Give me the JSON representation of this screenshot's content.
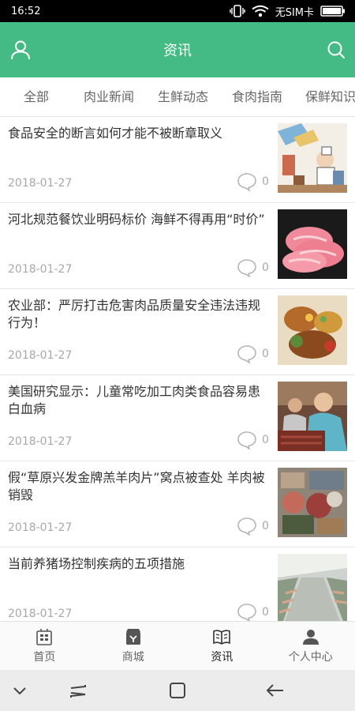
{
  "status_bar": {
    "time": "16:52",
    "carrier": "无SIM卡"
  },
  "header": {
    "title": "资讯"
  },
  "categories": [
    "全部",
    "肉业新闻",
    "生鲜动态",
    "食肉指南",
    "保鲜知识"
  ],
  "news": [
    {
      "title": "食品安全的断言如何才能不被断章取义",
      "date": "2018-01-27",
      "comments": "0"
    },
    {
      "title": "河北规范餐饮业明码标价 海鲜不得再用“时价”",
      "date": "2018-01-27",
      "comments": "0"
    },
    {
      "title": "农业部：严厉打击危害肉品质量安全违法违规行为！",
      "date": "2018-01-27",
      "comments": "0"
    },
    {
      "title": "美国研究显示：儿童常吃加工肉类食品容易患白血病",
      "date": "2018-01-27",
      "comments": "0"
    },
    {
      "title": "假“草原兴发金牌羔羊肉片”窝点被查处 羊肉被销毁",
      "date": "2018-01-27",
      "comments": "0"
    },
    {
      "title": "当前养猪场控制疾病的五项措施",
      "date": "2018-01-27",
      "comments": "0"
    }
  ],
  "tabs": [
    "首页",
    "商城",
    "资讯",
    "个人中心"
  ],
  "colors": {
    "accent": "#44bb84",
    "status_bar": "#000000",
    "text": "#333333",
    "muted": "#a8a8a8"
  },
  "icons": [
    "user-icon",
    "search-icon",
    "comment-icon",
    "home-icon",
    "shop-icon",
    "news-icon",
    "profile-icon",
    "wifi-icon",
    "battery-icon",
    "vibrate-icon"
  ]
}
